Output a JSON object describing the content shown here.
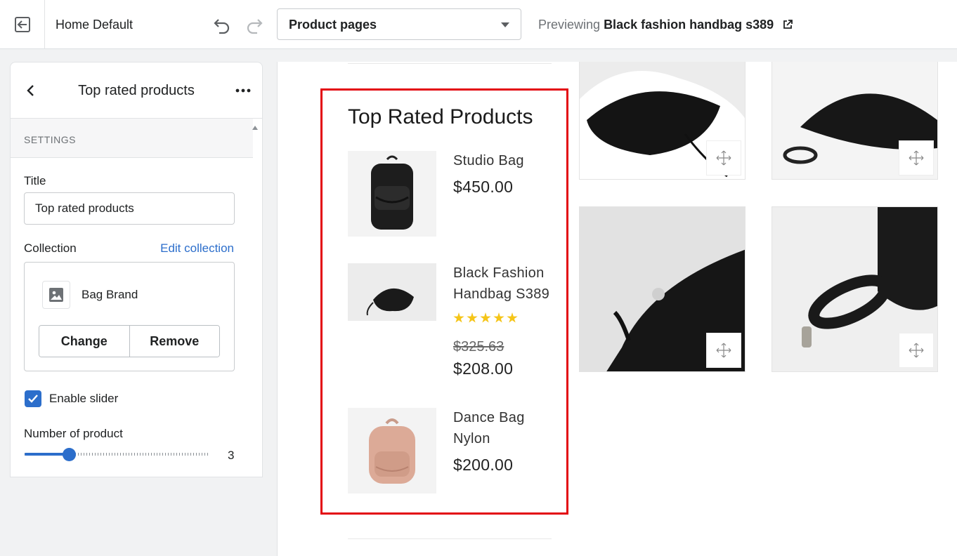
{
  "topbar": {
    "theme_name": "Home Default",
    "page_select": "Product pages",
    "previewing_label": "Previewing",
    "previewing_product": "Black fashion handbag s389"
  },
  "sidebar": {
    "title": "Top rated products",
    "section_label": "SETTINGS",
    "title_label": "Title",
    "title_value": "Top rated products",
    "collection_label": "Collection",
    "edit_collection": "Edit collection",
    "collection_name": "Bag Brand",
    "change_label": "Change",
    "remove_label": "Remove",
    "enable_slider_label": "Enable slider",
    "enable_slider_checked": true,
    "number_label": "Number of product",
    "number_value": "3",
    "slider_fraction": 0.24
  },
  "preview": {
    "section_title": "Top Rated Products",
    "products": [
      {
        "name": "Studio Bag",
        "price": "$450.00"
      },
      {
        "name": "Black Fashion Handbag S389",
        "rating": 5,
        "old_price": "$325.63",
        "price": "$208.00"
      },
      {
        "name": "Dance Bag Nylon",
        "price": "$200.00"
      }
    ]
  },
  "colors": {
    "accent": "#2c6ecb",
    "highlight": "#e3050f",
    "star": "#f5c518"
  }
}
